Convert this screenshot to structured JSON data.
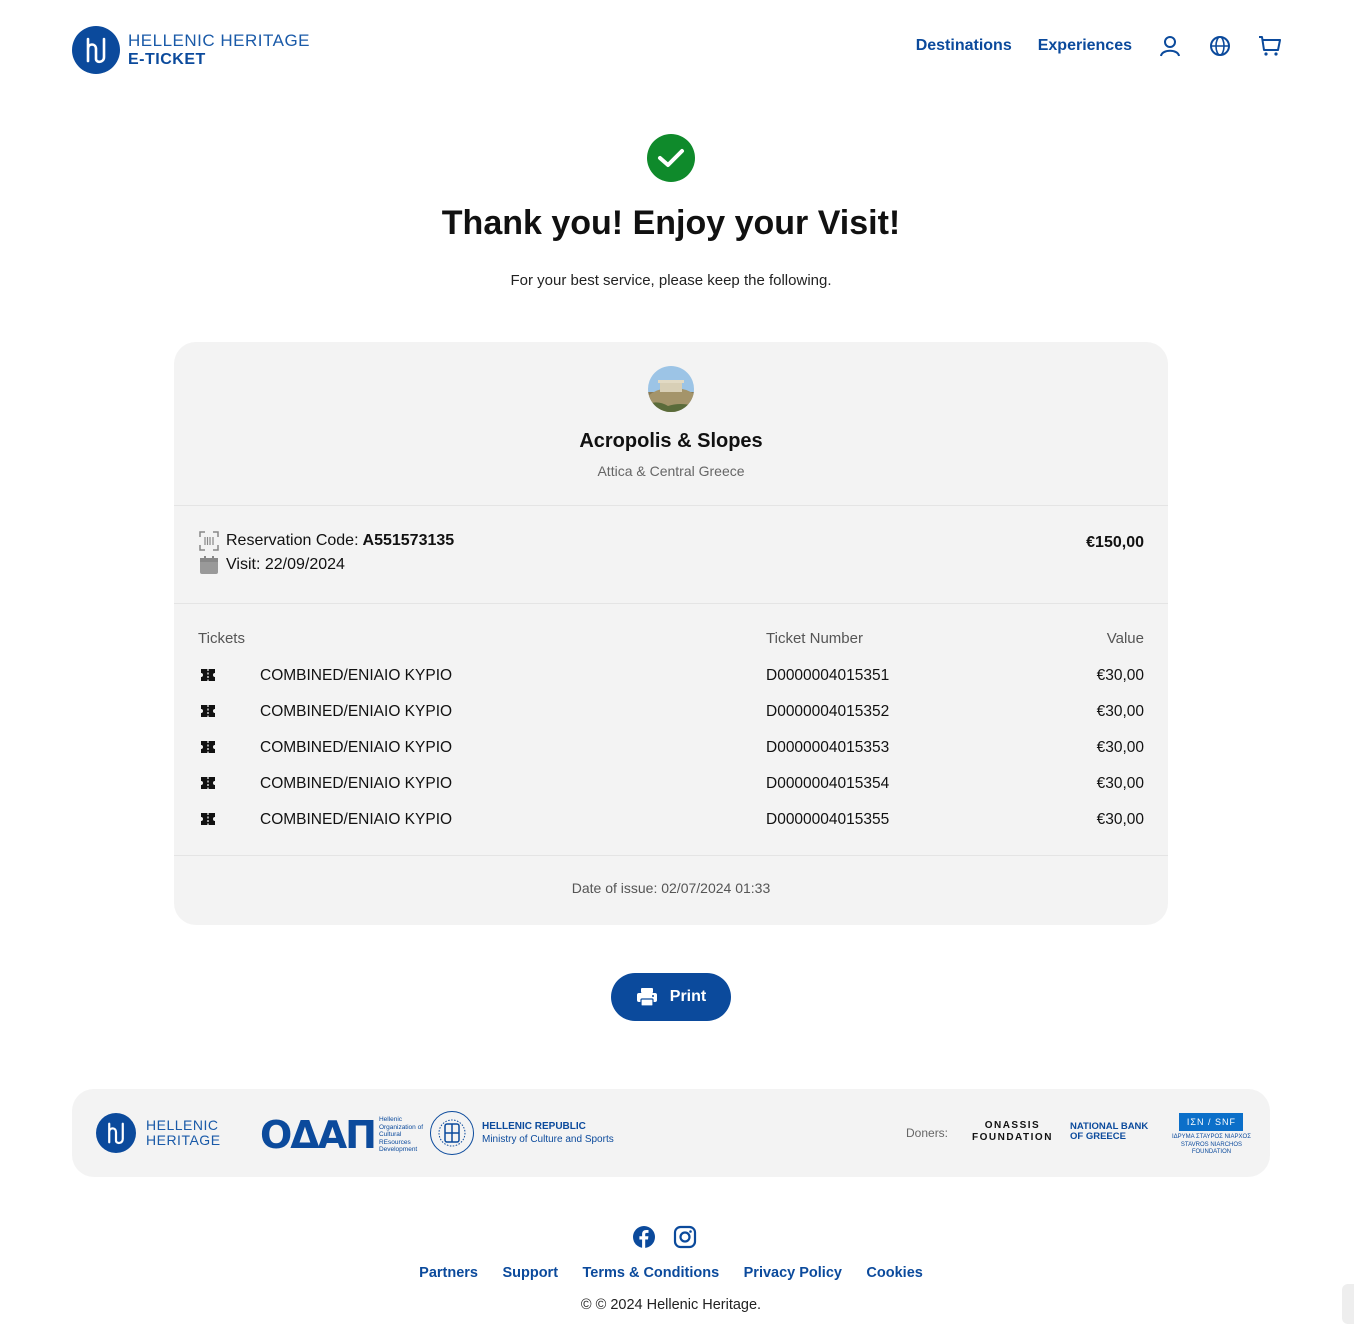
{
  "header": {
    "logo_line1": "HELLENIC HERITAGE",
    "logo_line2": "E-TICKET",
    "nav": [
      "Destinations",
      "Experiences"
    ],
    "icons": [
      "user-icon",
      "globe-icon",
      "cart-icon"
    ]
  },
  "hero": {
    "title": "Thank you! Enjoy your Visit!",
    "subtitle": "For your best service, please keep the following."
  },
  "site": {
    "name": "Acropolis & Slopes",
    "region": "Attica & Central Greece"
  },
  "reservation": {
    "code_label": "Reservation Code:",
    "code": "A551573135",
    "visit": "Visit: 22/09/2024",
    "total": "€150,00"
  },
  "tickets": {
    "headers": [
      "Tickets",
      "Ticket Number",
      "Value"
    ],
    "rows": [
      {
        "name": "COMBINED/ENIAIO KYPIO",
        "number": "D0000004015351",
        "value": "€30,00"
      },
      {
        "name": "COMBINED/ENIAIO KYPIO",
        "number": "D0000004015352",
        "value": "€30,00"
      },
      {
        "name": "COMBINED/ENIAIO KYPIO",
        "number": "D0000004015353",
        "value": "€30,00"
      },
      {
        "name": "COMBINED/ENIAIO KYPIO",
        "number": "D0000004015354",
        "value": "€30,00"
      },
      {
        "name": "COMBINED/ENIAIO KYPIO",
        "number": "D0000004015355",
        "value": "€30,00"
      }
    ]
  },
  "issue": "Date of issue: 02/07/2024 01:33",
  "print_label": "Print",
  "sponsors": {
    "hh_line1": "HELLENIC",
    "hh_line2": "HERITAGE",
    "odap_mark": "ΟΔΑΠ",
    "odap_text": [
      "Hellenic",
      "Organization of",
      "Cultural",
      "REsources",
      "Development"
    ],
    "republic_line1": "HELLENIC REPUBLIC",
    "republic_line2": "Ministry of Culture and Sports",
    "donors_label": "Doners:",
    "onassis": [
      "ONASSIS",
      "FOUNDATION"
    ],
    "nbg": [
      "NATIONAL BANK",
      "OF GREECE"
    ],
    "snf_box": "ΙΣΝ / SNF",
    "snf_sub": [
      "ΙΔΡΥΜΑ ΣΤΑΥΡΟΣ ΝΙΑΡΧΟΣ",
      "STAVROS NIARCHOS",
      "FOUNDATION"
    ]
  },
  "footer": {
    "social": [
      "facebook-icon",
      "instagram-icon"
    ],
    "links": [
      "Partners",
      "Support",
      "Terms & Conditions",
      "Privacy Policy",
      "Cookies"
    ],
    "copyright": "© © 2024 Hellenic Heritage."
  },
  "colors": {
    "brand": "#0b4a9c",
    "success": "#0f8a2b",
    "card_bg": "#f3f3f3"
  }
}
